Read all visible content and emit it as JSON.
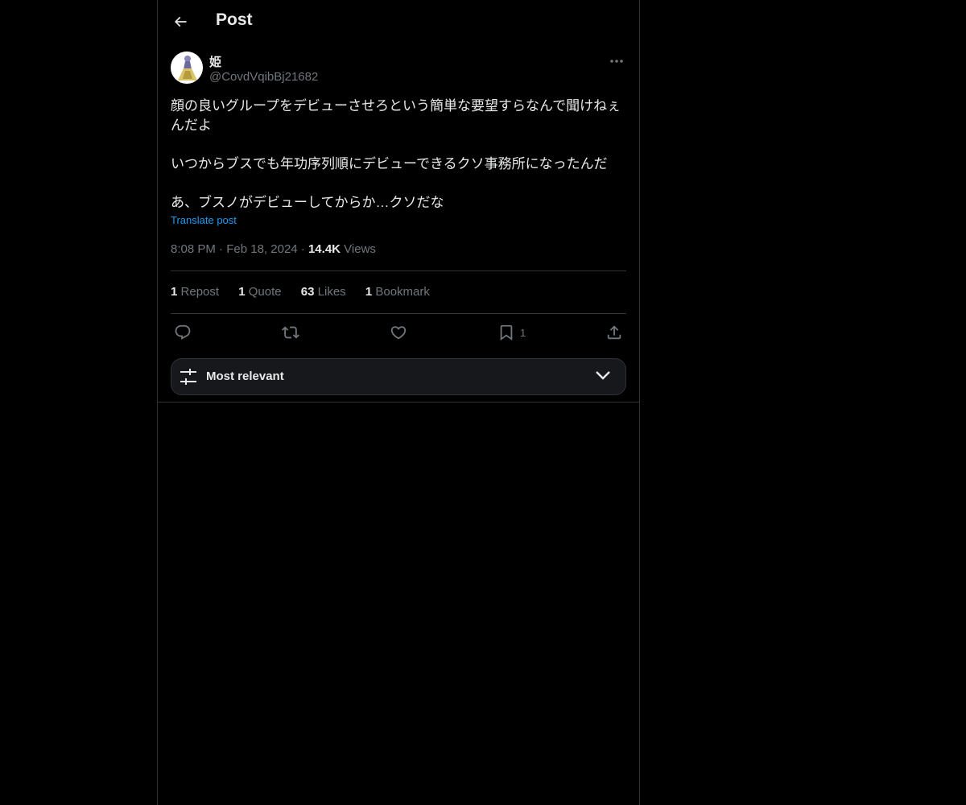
{
  "header": {
    "back_icon": "arrow-left-icon",
    "title": "Post"
  },
  "post": {
    "author": {
      "display_name": "姫",
      "handle": "@CovdVqibBj21682"
    },
    "more_icon": "more-horizontal-icon",
    "text": {
      "paragraph_1": "顔の良いグループをデビューさせろという簡単な要望すらなんで聞けねぇんだよ",
      "paragraph_2": "いつからブスでも年功序列順にデビューできるクソ事務所になったんだ",
      "paragraph_3": "あ、ブスノがデビューしてからか…クソだな"
    },
    "translate_label": "Translate post",
    "time": "8:08 PM",
    "separator": "·",
    "date": "Feb 18, 2024",
    "views_count": "14.4K",
    "views_label": "Views"
  },
  "stats": {
    "reposts": {
      "count": "1",
      "label": "Repost"
    },
    "quotes": {
      "count": "1",
      "label": "Quote"
    },
    "likes": {
      "count": "63",
      "label": "Likes"
    },
    "bookmarks": {
      "count": "1",
      "label": "Bookmark"
    }
  },
  "actions": {
    "reply_icon": "reply-icon",
    "repost_icon": "repost-icon",
    "like_icon": "heart-icon",
    "bookmark_icon": "bookmark-icon",
    "bookmark_count": "1",
    "share_icon": "share-icon"
  },
  "sort": {
    "icon": "sliders-icon",
    "label": "Most relevant",
    "chevron_icon": "chevron-down-icon"
  },
  "colors": {
    "background": "#000000",
    "text_primary": "#e7e9ea",
    "text_secondary": "#71767b",
    "link": "#1d9bf0",
    "border": "#2f3336"
  }
}
